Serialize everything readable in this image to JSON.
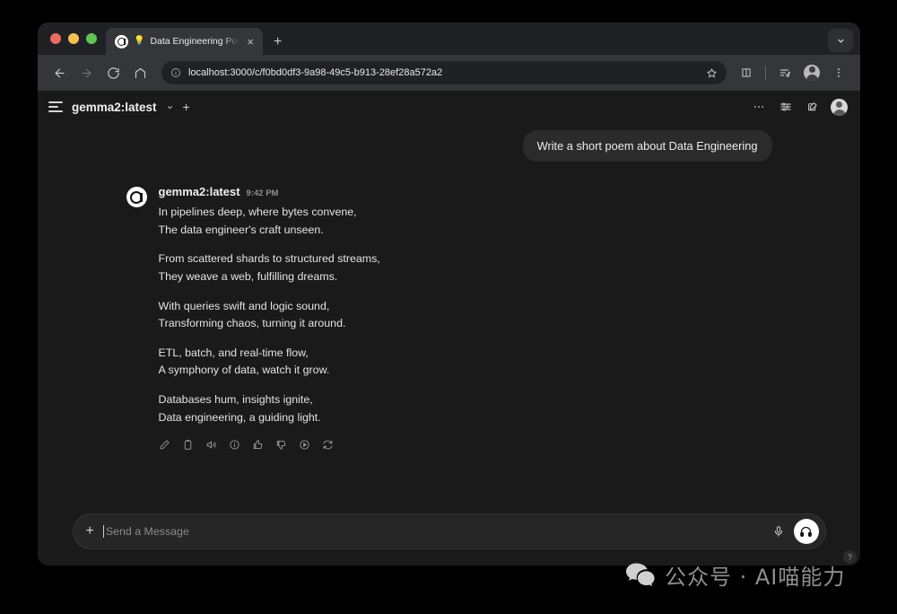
{
  "browser": {
    "traffic_lights": [
      "close",
      "minimize",
      "maximize"
    ],
    "tab": {
      "title": "Data Engineering Poem | O",
      "favicon": "openwebui-icon",
      "lock": "bulb-icon",
      "close_label": "×"
    },
    "new_tab_label": "+",
    "tab_search": "chevron-down-icon",
    "nav": {
      "back": "←",
      "forward": "→",
      "reload": "reload-icon",
      "home": "home-icon"
    },
    "omnibox": {
      "url": "localhost:3000/c/f0bd0df3-9a98-49c5-b913-28ef28a572a2",
      "info_icon": "info-circle-icon",
      "star_icon": "star-icon"
    },
    "toolbar_icons": [
      "split-screen-icon",
      "reading-list-icon",
      "profile-avatar",
      "kebab-menu-icon"
    ]
  },
  "app": {
    "header": {
      "menu_icon": "hamburger-icon",
      "model_name": "gemma2:latest",
      "model_chevron": "chevron-down-icon",
      "add_model": "+",
      "right_icons": [
        "kebab-menu-icon",
        "controls-icon",
        "new-chat-icon",
        "user-avatar"
      ]
    },
    "conversation": {
      "user_message": "Write a short poem about Data Engineering",
      "assistant": {
        "name": "gemma2:latest",
        "time": "9:42 PM",
        "avatar": "openwebui-logo",
        "stanzas": [
          [
            "In pipelines deep, where bytes convene,",
            "The data engineer's craft unseen."
          ],
          [
            "From scattered shards to structured streams,",
            "They weave a web, fulfilling dreams."
          ],
          [
            "With queries swift and logic sound,",
            "Transforming chaos, turning it around."
          ],
          [
            "ETL, batch, and real-time flow,",
            "A symphony of data, watch it grow."
          ],
          [
            "Databases hum, insights ignite,",
            "Data engineering, a guiding light."
          ]
        ],
        "actions": [
          "edit-icon",
          "copy-icon",
          "speaker-icon",
          "info-icon",
          "thumbs-up-icon",
          "thumbs-down-icon",
          "continue-icon",
          "regenerate-icon"
        ]
      }
    },
    "composer": {
      "add_label": "+",
      "placeholder": "Send a Message",
      "mic_icon": "microphone-icon",
      "call_icon": "headphones-icon"
    },
    "help_label": "?"
  },
  "watermark": {
    "icon": "wechat-icon",
    "text": "公众号 · AI喵能力"
  },
  "colors": {
    "page_background": "#000000",
    "browser_chrome": "#202124",
    "toolbar": "#35363a",
    "app_background": "#1a1a1a",
    "bubble": "#2b2b2b",
    "accent_white": "#ffffff"
  }
}
